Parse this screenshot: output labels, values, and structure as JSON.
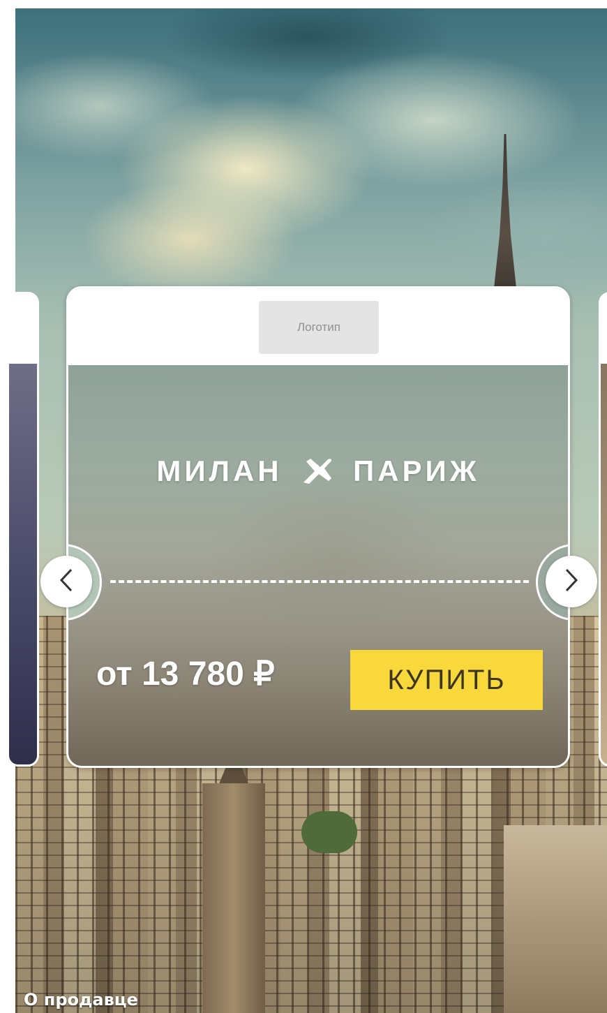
{
  "banner": {
    "logo_placeholder": "Логотип",
    "route": {
      "origin": "МИЛАН",
      "destination": "ПАРИЖ",
      "icon": "airplane-icon"
    },
    "price": "от 13 780 ₽",
    "buy_label": "КУПИТЬ",
    "footer_link": "О продавце"
  },
  "icons": {
    "prev": "chevron-left-icon",
    "next": "chevron-right-icon"
  },
  "colors": {
    "buy_button": "#f8d83a",
    "card_border": "#ffffff",
    "text": "#ffffff"
  }
}
